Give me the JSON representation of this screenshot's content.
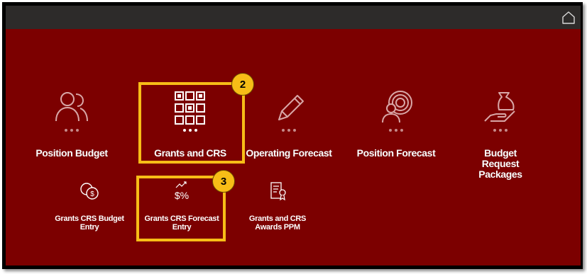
{
  "header": {
    "home_icon": "home-icon"
  },
  "colors": {
    "background": "#7c0000",
    "topbar": "#2d2b2a",
    "highlight": "#f7bd17"
  },
  "tiles_row1": [
    {
      "label": "Position Budget",
      "icon": "user-group-icon"
    },
    {
      "label": "Grants and CRS",
      "icon": "grid-icon"
    },
    {
      "label": "Operating Forecast",
      "icon": "pencil-icon"
    },
    {
      "label": "Position Forecast",
      "icon": "user-target-icon"
    },
    {
      "label": "Budget Request Packages",
      "icon": "hand-money-bag-icon"
    }
  ],
  "tiles_row2": [
    {
      "label": "Grants CRS Budget Entry",
      "icon": "coins-icon"
    },
    {
      "label": "Grants CRS Forecast Entry",
      "icon": "trend-percent-icon"
    },
    {
      "label": "Grants and CRS Awards PPM",
      "icon": "certificate-icon"
    }
  ],
  "callouts": [
    {
      "number": "2"
    },
    {
      "number": "3"
    }
  ]
}
